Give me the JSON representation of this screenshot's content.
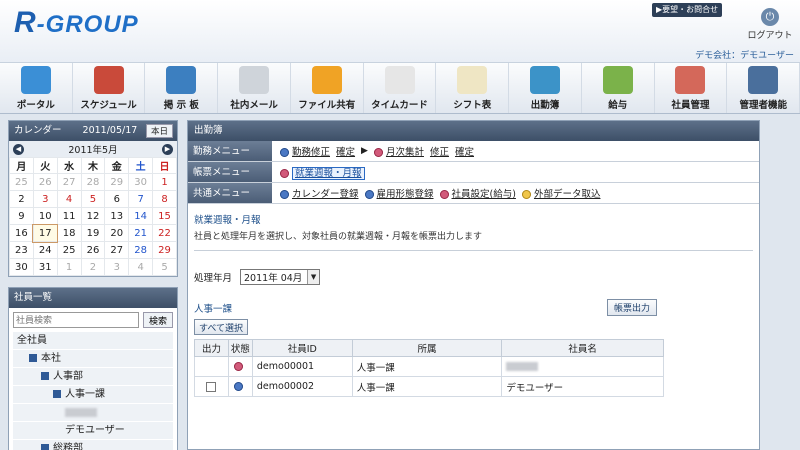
{
  "header": {
    "logo_letter": "R",
    "logo_text": "-GROUP",
    "inquiry": "▶要望・お問合せ",
    "logout": "ログアウト",
    "company": "デモ会社：デモユーザー"
  },
  "toolbar": [
    {
      "id": "portal",
      "label": "ポータル",
      "icon": "house-icon",
      "color": "#3b8fd6"
    },
    {
      "id": "schedule",
      "label": "スケジュール",
      "icon": "calendar-icon",
      "color": "#c94a3a"
    },
    {
      "id": "board",
      "label": "掲 示 板",
      "icon": "board-icon",
      "color": "#3c7fc0"
    },
    {
      "id": "mail",
      "label": "社内メール",
      "icon": "envelope-icon",
      "color": "#cfd4da"
    },
    {
      "id": "files",
      "label": "ファイル共有",
      "icon": "folder-icon",
      "color": "#f0a325"
    },
    {
      "id": "timecard",
      "label": "タイムカード",
      "icon": "clock-icon",
      "color": "#e6e6e6"
    },
    {
      "id": "shift",
      "label": "シフト表",
      "icon": "notepad-icon",
      "color": "#efe6c4"
    },
    {
      "id": "attendance",
      "label": "出勤簿",
      "icon": "tie-icon",
      "color": "#3c93c8"
    },
    {
      "id": "salary",
      "label": "給与",
      "icon": "money-icon",
      "color": "#7bb24a"
    },
    {
      "id": "staff",
      "label": "社員管理",
      "icon": "people-icon",
      "color": "#d4685a"
    },
    {
      "id": "admin",
      "label": "管理者機能",
      "icon": "admin-icon",
      "color": "#4a6f9c"
    }
  ],
  "calendar": {
    "title": "カレンダー",
    "date": "2011/05/17",
    "today_btn": "本日",
    "month": "2011年5月",
    "weekdays": [
      "月",
      "火",
      "水",
      "木",
      "金",
      "土",
      "日"
    ],
    "weeks": [
      [
        "25",
        "26",
        "27",
        "28",
        "29",
        "30",
        "1"
      ],
      [
        "2",
        "3",
        "4",
        "5",
        "6",
        "7",
        "8"
      ],
      [
        "9",
        "10",
        "11",
        "12",
        "13",
        "14",
        "15"
      ],
      [
        "16",
        "17",
        "18",
        "19",
        "20",
        "21",
        "22"
      ],
      [
        "23",
        "24",
        "25",
        "26",
        "27",
        "28",
        "29"
      ],
      [
        "30",
        "31",
        "1",
        "2",
        "3",
        "4",
        "5"
      ]
    ],
    "holidays": [
      "3",
      "4",
      "5"
    ],
    "today": "17"
  },
  "employees": {
    "title": "社員一覧",
    "search_placeholder": "社員検索",
    "search_btn": "検索",
    "tree": [
      {
        "label": "全社員",
        "level": 0,
        "box": false
      },
      {
        "label": "本社",
        "level": 1,
        "box": true
      },
      {
        "label": "人事部",
        "level": 2,
        "box": true
      },
      {
        "label": "人事一課",
        "level": 3,
        "box": true
      },
      {
        "label": "",
        "level": 4,
        "box": false,
        "blurred": true
      },
      {
        "label": "デモユーザー",
        "level": 4,
        "box": false
      },
      {
        "label": "総務部",
        "level": 2,
        "box": true
      }
    ]
  },
  "main": {
    "title": "出勤簿",
    "menus": [
      {
        "label": "勤務メニュー",
        "items": [
          {
            "dot": "b",
            "text": "勤務修正"
          },
          {
            "dot": "",
            "text": "確定"
          },
          {
            "dot": "play",
            "text": "▶"
          },
          {
            "dot": "r",
            "text": "月次集計"
          },
          {
            "dot": "",
            "text": "修正"
          },
          {
            "dot": "",
            "text": "確定"
          }
        ]
      },
      {
        "label": "帳票メニュー",
        "items": [
          {
            "dot": "r",
            "text": "就業週報・月報",
            "active": true
          }
        ]
      },
      {
        "label": "共通メニュー",
        "items": [
          {
            "dot": "b",
            "text": "カレンダー登録"
          },
          {
            "dot": "b",
            "text": "雇用形態登録"
          },
          {
            "dot": "r",
            "text": "社員設定(給与)"
          },
          {
            "dot": "y",
            "text": "外部データ取込"
          }
        ]
      }
    ],
    "section_title": "就業週報・月報",
    "section_desc": "社員と処理年月を選択し、対象社員の就業週報・月報を帳票出力します",
    "ym_label": "処理年月",
    "ym_value": "2011年 04月",
    "dept": "人事一課",
    "output_btn": "帳票出力",
    "select_all": "すべて選択",
    "table": {
      "headers": [
        "出力",
        "状態",
        "社員ID",
        "所属",
        "社員名"
      ],
      "rows": [
        {
          "checkbox": false,
          "status": "r",
          "id": "demo00001",
          "dept": "人事一課",
          "name": "",
          "blurred": true
        },
        {
          "checkbox": true,
          "status": "b",
          "id": "demo00002",
          "dept": "人事一課",
          "name": "デモユーザー",
          "blurred": false
        }
      ]
    }
  }
}
